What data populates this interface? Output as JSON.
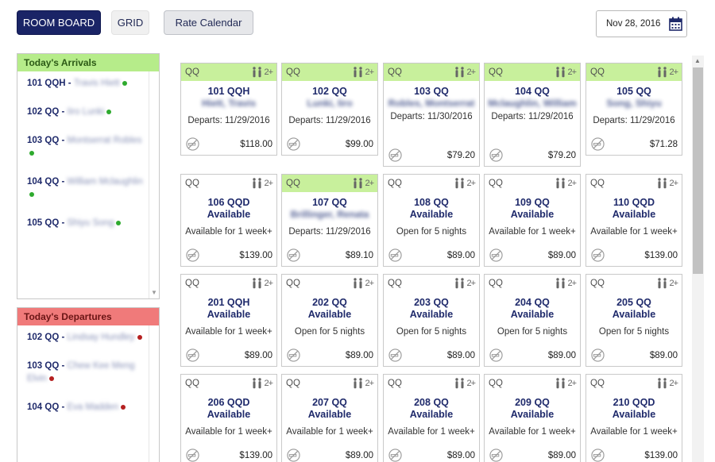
{
  "toolbar": {
    "room_board": "ROOM BOARD",
    "grid": "GRID",
    "rate_calendar": "Rate Calendar",
    "date": "Nov 28, 2016"
  },
  "arrivals": {
    "title": "Today's Arrivals",
    "items": [
      {
        "room": "101 QQH",
        "name": "Travis Hiett"
      },
      {
        "room": "102 QQ",
        "name": "Iiro Lunki"
      },
      {
        "room": "103 QQ",
        "name": "Montserrat Robles"
      },
      {
        "room": "104 QQ",
        "name": "William Mclaughlin"
      },
      {
        "room": "105 QQ",
        "name": "Shiyu Song"
      }
    ]
  },
  "departures": {
    "title": "Today's Departures",
    "items": [
      {
        "room": "102 QQ",
        "name": "Lindsay Hundley"
      },
      {
        "room": "103 QQ",
        "name": "Chew Kee Meng Elvin"
      },
      {
        "room": "104 QQ",
        "name": "Eva Madden"
      }
    ]
  },
  "rooms": [
    {
      "type": "QQ",
      "occ": "2+",
      "room": "101 QQH",
      "guest": "Hiett, Travis",
      "status": "Departs: 11/29/2016",
      "price": "$118.00",
      "occupied": true
    },
    {
      "type": "QQ",
      "occ": "2+",
      "room": "102 QQ",
      "guest": "Lunki, Iiro",
      "status": "Departs: 11/29/2016",
      "price": "$99.00",
      "occupied": true
    },
    {
      "type": "QQ",
      "occ": "2+",
      "room": "103 QQ",
      "guest": "Robles, Montserrat",
      "status": "Departs: 11/30/2016",
      "price": "$79.20",
      "occupied": true
    },
    {
      "type": "QQ",
      "occ": "2+",
      "room": "104 QQ",
      "guest": "Mclaughlin, William",
      "status": "Departs: 11/29/2016",
      "price": "$79.20",
      "occupied": true
    },
    {
      "type": "QQ",
      "occ": "2+",
      "room": "105 QQ",
      "guest": "Song, Shiyu",
      "status": "Departs: 11/29/2016",
      "price": "$71.28",
      "occupied": true
    },
    {
      "type": "QQ",
      "occ": "2+",
      "room": "106 QQD",
      "guest": "Available",
      "status": "Available for 1 week+",
      "price": "$139.00",
      "occupied": false
    },
    {
      "type": "QQ",
      "occ": "2+",
      "room": "107 QQ",
      "guest": "Brillinger, Renata",
      "status": "Departs: 11/29/2016",
      "price": "$89.10",
      "occupied": true
    },
    {
      "type": "QQ",
      "occ": "2+",
      "room": "108 QQ",
      "guest": "Available",
      "status": "Open for 5 nights",
      "price": "$89.00",
      "occupied": false
    },
    {
      "type": "QQ",
      "occ": "2+",
      "room": "109 QQ",
      "guest": "Available",
      "status": "Available for 1 week+",
      "price": "$89.00",
      "occupied": false
    },
    {
      "type": "QQ",
      "occ": "2+",
      "room": "110 QQD",
      "guest": "Available",
      "status": "Available for 1 week+",
      "price": "$139.00",
      "occupied": false
    },
    {
      "type": "QQ",
      "occ": "2+",
      "room": "201 QQH",
      "guest": "Available",
      "status": "Available for 1 week+",
      "price": "$89.00",
      "occupied": false
    },
    {
      "type": "QQ",
      "occ": "2+",
      "room": "202 QQ",
      "guest": "Available",
      "status": "Open for 5 nights",
      "price": "$89.00",
      "occupied": false
    },
    {
      "type": "QQ",
      "occ": "2+",
      "room": "203 QQ",
      "guest": "Available",
      "status": "Open for 5 nights",
      "price": "$89.00",
      "occupied": false
    },
    {
      "type": "QQ",
      "occ": "2+",
      "room": "204 QQ",
      "guest": "Available",
      "status": "Open for 5 nights",
      "price": "$89.00",
      "occupied": false
    },
    {
      "type": "QQ",
      "occ": "2+",
      "room": "205 QQ",
      "guest": "Available",
      "status": "Open for 5 nights",
      "price": "$89.00",
      "occupied": false
    },
    {
      "type": "QQ",
      "occ": "2+",
      "room": "206 QQD",
      "guest": "Available",
      "status": "Available for 1 week+",
      "price": "$139.00",
      "occupied": false
    },
    {
      "type": "QQ",
      "occ": "2+",
      "room": "207 QQ",
      "guest": "Available",
      "status": "Available for 1 week+",
      "price": "$89.00",
      "occupied": false
    },
    {
      "type": "QQ",
      "occ": "2+",
      "room": "208 QQ",
      "guest": "Available",
      "status": "Available for 1 week+",
      "price": "$89.00",
      "occupied": false
    },
    {
      "type": "QQ",
      "occ": "2+",
      "room": "209 QQ",
      "guest": "Available",
      "status": "Available for 1 week+",
      "price": "$89.00",
      "occupied": false
    },
    {
      "type": "QQ",
      "occ": "2+",
      "room": "210 QQD",
      "guest": "Available",
      "status": "Available for 1 week+",
      "price": "$139.00",
      "occupied": false
    }
  ]
}
